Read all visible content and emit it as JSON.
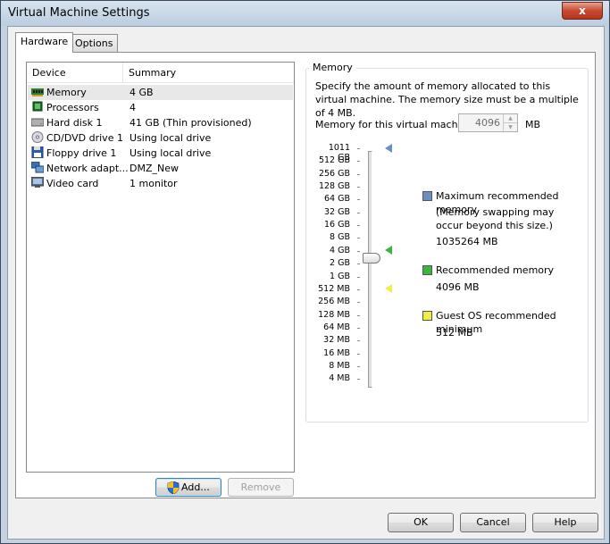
{
  "window": {
    "title": "Virtual Machine Settings",
    "close_glyph": "x"
  },
  "tabs": [
    {
      "label": "Hardware"
    },
    {
      "label": "Options"
    }
  ],
  "device_list": {
    "headers": {
      "device": "Device",
      "summary": "Summary"
    },
    "rows": [
      {
        "device": "Memory",
        "summary": "4 GB",
        "icon": "memory-icon"
      },
      {
        "device": "Processors",
        "summary": "4",
        "icon": "processor-icon"
      },
      {
        "device": "Hard disk 1",
        "summary": "41 GB (Thin provisioned)",
        "icon": "hard-disk-icon"
      },
      {
        "device": "CD/DVD drive 1",
        "summary": "Using local drive",
        "icon": "cd-dvd-icon"
      },
      {
        "device": "Floppy drive 1",
        "summary": "Using local drive",
        "icon": "floppy-icon"
      },
      {
        "device": "Network adapt...",
        "summary": "DMZ_New",
        "icon": "network-adapter-icon"
      },
      {
        "device": "Video card",
        "summary": "1 monitor",
        "icon": "video-card-icon"
      }
    ],
    "selected": "Memory"
  },
  "buttons": {
    "add": "Add...",
    "remove": "Remove",
    "ok": "OK",
    "cancel": "Cancel",
    "help": "Help"
  },
  "memory": {
    "group_label": "Memory",
    "description": "Specify the amount of memory allocated to this virtual machine. The memory size must be a multiple of 4 MB.",
    "field_label": "Memory for this virtual machine:",
    "value": "4096",
    "unit": "MB",
    "scale": [
      "1011 GB",
      "512 GB",
      "256 GB",
      "128 GB",
      "64 GB",
      "32 GB",
      "16 GB",
      "8 GB",
      "4 GB",
      "2 GB",
      "1 GB",
      "512 MB",
      "256 MB",
      "128 MB",
      "64 MB",
      "32 MB",
      "16 MB",
      "8 MB",
      "4 MB"
    ],
    "slider_value": "4 GB",
    "legend": {
      "max": {
        "label": "Maximum recommended memory",
        "note": "(Memory swapping may occur beyond this size.)",
        "value": "1035264 MB",
        "color": "#6b8fc3"
      },
      "recommended": {
        "label": "Recommended memory",
        "value": "4096 MB",
        "color": "#3cb53c"
      },
      "guest_min": {
        "label": "Guest OS recommended minimum",
        "value": "512 MB",
        "color": "#f2ec43"
      }
    }
  }
}
